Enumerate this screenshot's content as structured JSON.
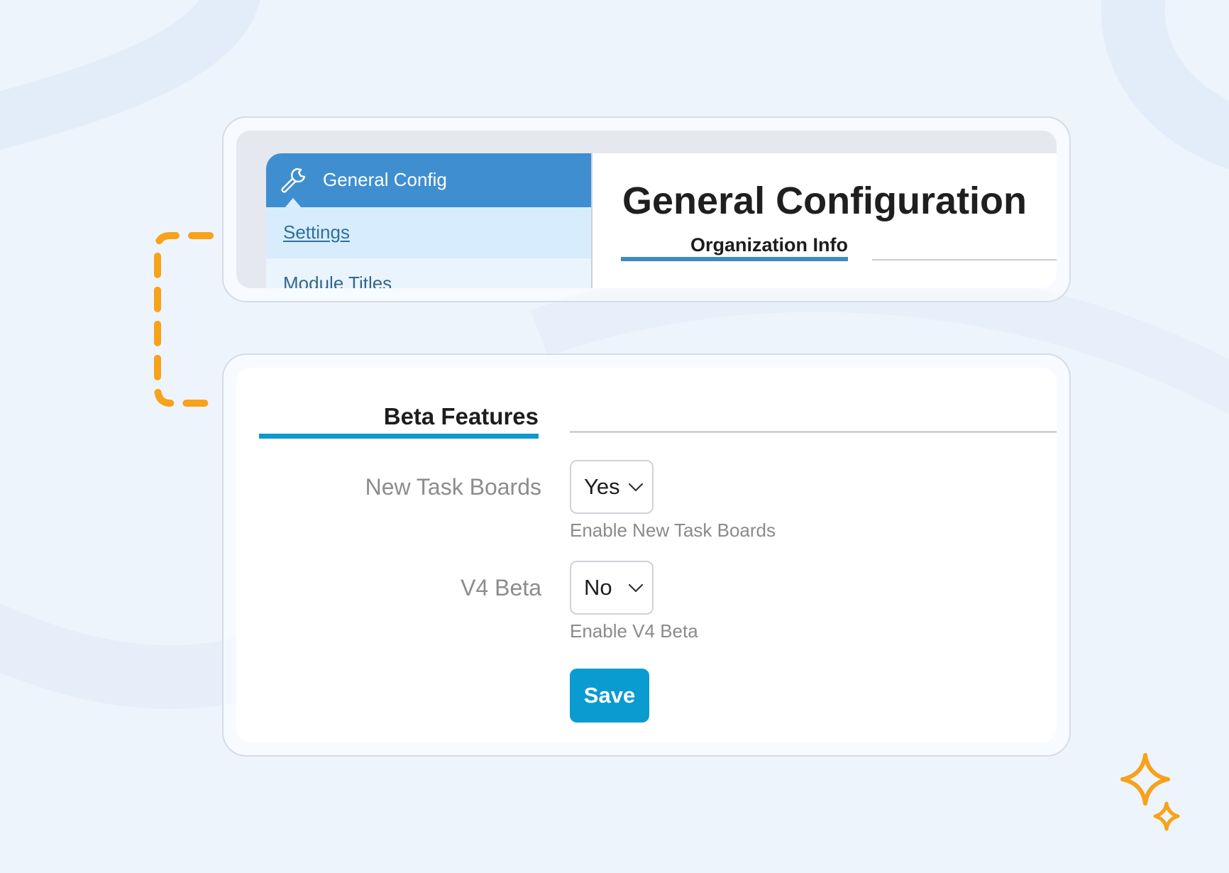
{
  "top_panel": {
    "sidebar": {
      "header_title": "General Config",
      "header_icon": "wrench-icon",
      "items": [
        {
          "label": "Settings",
          "active": true
        },
        {
          "label": "Module Titles",
          "active": false
        }
      ]
    },
    "page_title": "General Configuration",
    "active_tab": "Organization Info"
  },
  "bottom_panel": {
    "section_title": "Beta Features",
    "fields": [
      {
        "label": "New Task Boards",
        "value": "Yes",
        "help": "Enable New Task Boards"
      },
      {
        "label": "V4 Beta",
        "value": "No",
        "help": "Enable V4 Beta"
      }
    ],
    "save_label": "Save"
  },
  "colors": {
    "header_blue": "#3f8ed0",
    "tab_underline": "#0d98cf",
    "save_button": "#0a9bd0",
    "connector_orange": "#f7a21b",
    "background": "#eef4fc"
  }
}
